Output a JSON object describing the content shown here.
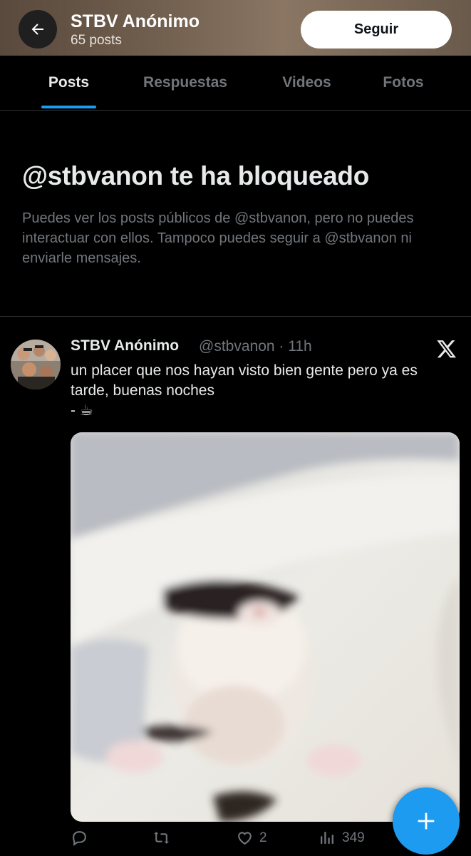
{
  "header": {
    "title": "STBV Anónimo",
    "posts_count": "65 posts",
    "follow_label": "Seguir"
  },
  "tabs": [
    {
      "label": "Posts",
      "active": true
    },
    {
      "label": "Respuestas",
      "active": false
    },
    {
      "label": "Videos",
      "active": false
    },
    {
      "label": "Fotos",
      "active": false
    }
  ],
  "blocked": {
    "title": "@stbvanon te ha bloqueado",
    "description": "Puedes ver los posts públicos de @stbvanon, pero no puedes interactuar con ellos. Tampoco puedes seguir a @stbvanon ni enviarle mensajes."
  },
  "post": {
    "author": "STBV Anónimo",
    "handle_time": "@stbvanon · 11h",
    "text": "un placer que nos hayan visto bien gente pero ya es tarde, buenas noches\n- ☕",
    "actions": {
      "reply_count": "",
      "repost_count": "",
      "like_count": "2",
      "views_count": "349"
    }
  },
  "colors": {
    "accent": "#1d9bf0",
    "background": "#000000",
    "muted_text": "#71767b",
    "primary_text": "#e7e9ea"
  },
  "icons": [
    "back-arrow-icon",
    "x-logo-icon",
    "reply-icon",
    "repost-icon",
    "like-icon",
    "views-icon",
    "share-icon",
    "plus-icon"
  ]
}
